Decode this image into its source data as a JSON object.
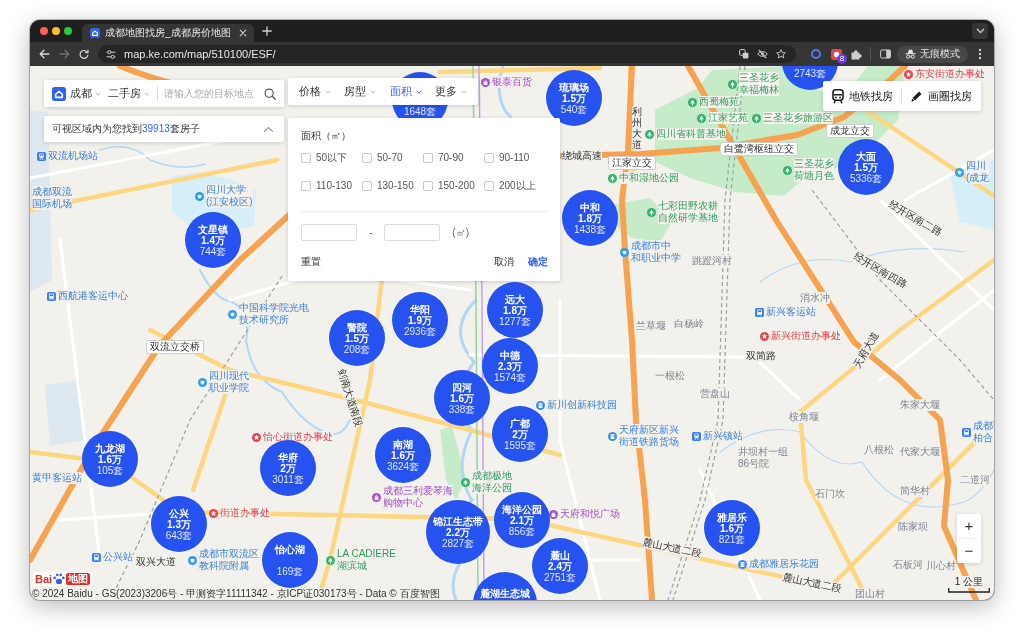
{
  "browser": {
    "tab_title": "成都地图找房_成都房价地图",
    "url": "map.ke.com/map/510100/ESF/",
    "extension_badge": "8",
    "incognito_label": "无痕模式"
  },
  "search_panel": {
    "city": "成都",
    "category": "二手房",
    "placeholder": "请输入您的目标地点"
  },
  "result_bar": {
    "prefix": "可视区域内为您找到",
    "count": "39913",
    "suffix": "套房子",
    "expanded": true
  },
  "filters": [
    {
      "label": "价格",
      "selected": false
    },
    {
      "label": "房型",
      "selected": false
    },
    {
      "label": "面积",
      "selected": true
    },
    {
      "label": "更多",
      "selected": false
    }
  ],
  "area_panel": {
    "title": "面积（㎡）",
    "options": [
      {
        "label": "50以下",
        "checked": false
      },
      {
        "label": "50-70",
        "checked": false
      },
      {
        "label": "70-90",
        "checked": false
      },
      {
        "label": "90-110",
        "checked": false
      },
      {
        "label": "110-130",
        "checked": false
      },
      {
        "label": "130-150",
        "checked": false
      },
      {
        "label": "150-200",
        "checked": false
      },
      {
        "label": "200以上",
        "checked": false
      }
    ],
    "range_separator": "-",
    "unit": "(㎡)",
    "reset": "重置",
    "cancel": "取消",
    "confirm": "确定"
  },
  "map_tools": [
    {
      "kind": "subway",
      "label": "地铁找房"
    },
    {
      "kind": "draw",
      "label": "画圈找房"
    }
  ],
  "zoom_control": {
    "zoom_in": "+",
    "zoom_out": "−"
  },
  "scale": "1 公里",
  "logo": {
    "latin": "Bai",
    "chinese": "地图"
  },
  "copyright": "© 2024 Baidu - GS(2023)3206号 - 甲测资字11111342 - 京ICP证030173号 - Data © 百度智图",
  "clusters": [
    {
      "count": "1648套"
    },
    {
      "name": "琉璃场",
      "price": "1.5万",
      "count": "540套"
    },
    {
      "count": "2743套"
    },
    {
      "name": "文星镇",
      "price": "1.4万",
      "count": "744套"
    },
    {
      "name": "中和",
      "price": "1.8万",
      "count": "1438套"
    },
    {
      "name": "大面",
      "price": "1.5万",
      "count": "5336套"
    },
    {
      "name": "警院",
      "price": "1.5万",
      "count": "208套"
    },
    {
      "name": "华阳",
      "price": "1.9万",
      "count": "2936套"
    },
    {
      "name": "远大",
      "price": "1.8万",
      "count": "1277套"
    },
    {
      "name": "四河",
      "price": "1.6万",
      "count": "338套"
    },
    {
      "name": "中德",
      "price": "2.3万",
      "count": "1574套"
    },
    {
      "name": "九龙湖",
      "price": "1.6万",
      "count": "105套"
    },
    {
      "name": "华府",
      "price": "2万",
      "count": "3011套"
    },
    {
      "name": "南湖",
      "price": "1.6万",
      "count": "3624套"
    },
    {
      "name": "广都",
      "price": "2万",
      "count": "1595套"
    },
    {
      "name": "公兴",
      "price": "1.3万",
      "count": "643套"
    },
    {
      "name": "怡心湖",
      "count": "169套"
    },
    {
      "name": "锦江生态带",
      "price": "2.2万",
      "count": "2827套"
    },
    {
      "name": "海洋公园",
      "price": "2.1万",
      "count": "856套"
    },
    {
      "name": "麓湖生态城"
    },
    {
      "name": "麓山",
      "price": "2.4万",
      "count": "2751套"
    },
    {
      "name": "雅居乐",
      "price": "1.6万",
      "count": "821套"
    }
  ],
  "labels": [
    {
      "kind": "mall",
      "lines": [
        "银泰百货"
      ]
    },
    {
      "kind": "park",
      "lines": [
        "三圣花乡",
        "幸福梅林"
      ]
    },
    {
      "kind": "office",
      "lines": [
        "东安街道办事处"
      ]
    },
    {
      "kind": "park",
      "lines": [
        "西蜀梅苑"
      ]
    },
    {
      "kind": "road",
      "lines": [
        "利州大道"
      ]
    },
    {
      "kind": "park",
      "lines": [
        "江家艺苑"
      ]
    },
    {
      "kind": "park",
      "lines": [
        "三圣花乡旅游区"
      ]
    },
    {
      "kind": "park",
      "lines": [
        "四川省科普基地"
      ]
    },
    {
      "kind": "junction",
      "lines": [
        "成龙立交"
      ]
    },
    {
      "kind": "metro",
      "lines": [
        "双流机场站"
      ]
    },
    {
      "kind": "road",
      "lines": [
        "绕城高速"
      ]
    },
    {
      "kind": "junction",
      "lines": [
        "白鹭湾枢纽立交"
      ]
    },
    {
      "kind": "junction",
      "lines": [
        "江家立交"
      ]
    },
    {
      "kind": "park",
      "lines": [
        "中和湿地公园"
      ]
    },
    {
      "kind": "park",
      "lines": [
        "三圣花乡",
        "荷塘月色"
      ]
    },
    {
      "kind": "school",
      "lines": [
        "四川",
        "(成龙"
      ]
    },
    {
      "kind": "area",
      "lines": [
        "成都双流",
        "国际机场"
      ]
    },
    {
      "kind": "school",
      "lines": [
        "四川大学",
        "(江安校区)"
      ]
    },
    {
      "kind": "park",
      "lines": [
        "七彩田野农耕",
        "自然研学基地"
      ]
    },
    {
      "kind": "road",
      "lines": [
        "经开区南二路"
      ]
    },
    {
      "kind": "school",
      "lines": [
        "成都市中",
        "和职业中学"
      ]
    },
    {
      "kind": "place",
      "lines": [
        "跳蹬河村"
      ]
    },
    {
      "kind": "road",
      "lines": [
        "经开区南四路"
      ]
    },
    {
      "kind": "bus",
      "lines": [
        "西航港客运中心"
      ]
    },
    {
      "kind": "place",
      "lines": [
        "消水冲"
      ]
    },
    {
      "kind": "school",
      "lines": [
        "中国科学院光电",
        "技术研究所"
      ]
    },
    {
      "kind": "bus",
      "lines": [
        "新兴客运站"
      ]
    },
    {
      "kind": "place",
      "lines": [
        "兰草堰"
      ]
    },
    {
      "kind": "place",
      "lines": [
        "白杨岭"
      ]
    },
    {
      "kind": "office",
      "lines": [
        "新兴街道办事处"
      ]
    },
    {
      "kind": "junction",
      "lines": [
        "双流立交桥"
      ]
    },
    {
      "kind": "road",
      "lines": [
        "双简路"
      ]
    },
    {
      "kind": "road",
      "lines": [
        "天府大道"
      ]
    },
    {
      "kind": "school",
      "lines": [
        "四川现代",
        "职业学院"
      ]
    },
    {
      "kind": "road",
      "lines": [
        "剑南大道南段"
      ]
    },
    {
      "kind": "place",
      "lines": [
        "一根松"
      ]
    },
    {
      "kind": "place",
      "lines": [
        "营盘山"
      ]
    },
    {
      "kind": "building",
      "lines": [
        "新川创新科技园"
      ]
    },
    {
      "kind": "place",
      "lines": [
        "朱家大堰"
      ]
    },
    {
      "kind": "place",
      "lines": [
        "桉角堰"
      ]
    },
    {
      "kind": "office",
      "lines": [
        "怡心街道办事处"
      ]
    },
    {
      "kind": "building",
      "lines": [
        "天府新区新兴",
        "街道铁路货场"
      ]
    },
    {
      "kind": "metro",
      "lines": [
        "新兴镇站"
      ]
    },
    {
      "kind": "bus",
      "lines": [
        "成都",
        "柏合"
      ]
    },
    {
      "kind": "place",
      "lines": [
        "井坝村一组",
        "86号院"
      ]
    },
    {
      "kind": "place",
      "lines": [
        "八根松"
      ]
    },
    {
      "kind": "place",
      "lines": [
        "代家大堰"
      ]
    },
    {
      "kind": "area",
      "lines": [
        "黄甲客运站"
      ]
    },
    {
      "kind": "mall",
      "lines": [
        "成都三利爱琴海",
        "购物中心"
      ]
    },
    {
      "kind": "park",
      "lines": [
        "成都极地",
        "海洋公园"
      ]
    },
    {
      "kind": "place",
      "lines": [
        "二道河"
      ]
    },
    {
      "kind": "place",
      "lines": [
        "石门坎"
      ]
    },
    {
      "kind": "place",
      "lines": [
        "简华村"
      ]
    },
    {
      "kind": "office",
      "lines": [
        "街道办事处"
      ]
    },
    {
      "kind": "mall",
      "lines": [
        "天府和悦广场"
      ]
    },
    {
      "kind": "place",
      "lines": [
        "陈家坝"
      ]
    },
    {
      "kind": "bus",
      "lines": [
        "公兴站"
      ]
    },
    {
      "kind": "road",
      "lines": [
        "双兴大道"
      ]
    },
    {
      "kind": "school",
      "lines": [
        "成都市双流区",
        "教科院附属"
      ]
    },
    {
      "kind": "park",
      "lines": [
        "LA CADIERE",
        "湖滨城"
      ]
    },
    {
      "kind": "road",
      "lines": [
        "麓山大道二段"
      ]
    },
    {
      "kind": "building",
      "lines": [
        "成都雅居乐花园"
      ]
    },
    {
      "kind": "place",
      "lines": [
        "石板河"
      ]
    },
    {
      "kind": "place",
      "lines": [
        "川心村"
      ]
    },
    {
      "kind": "road",
      "lines": [
        "麓山大道二段"
      ]
    },
    {
      "kind": "place",
      "lines": [
        "团山村"
      ]
    }
  ]
}
